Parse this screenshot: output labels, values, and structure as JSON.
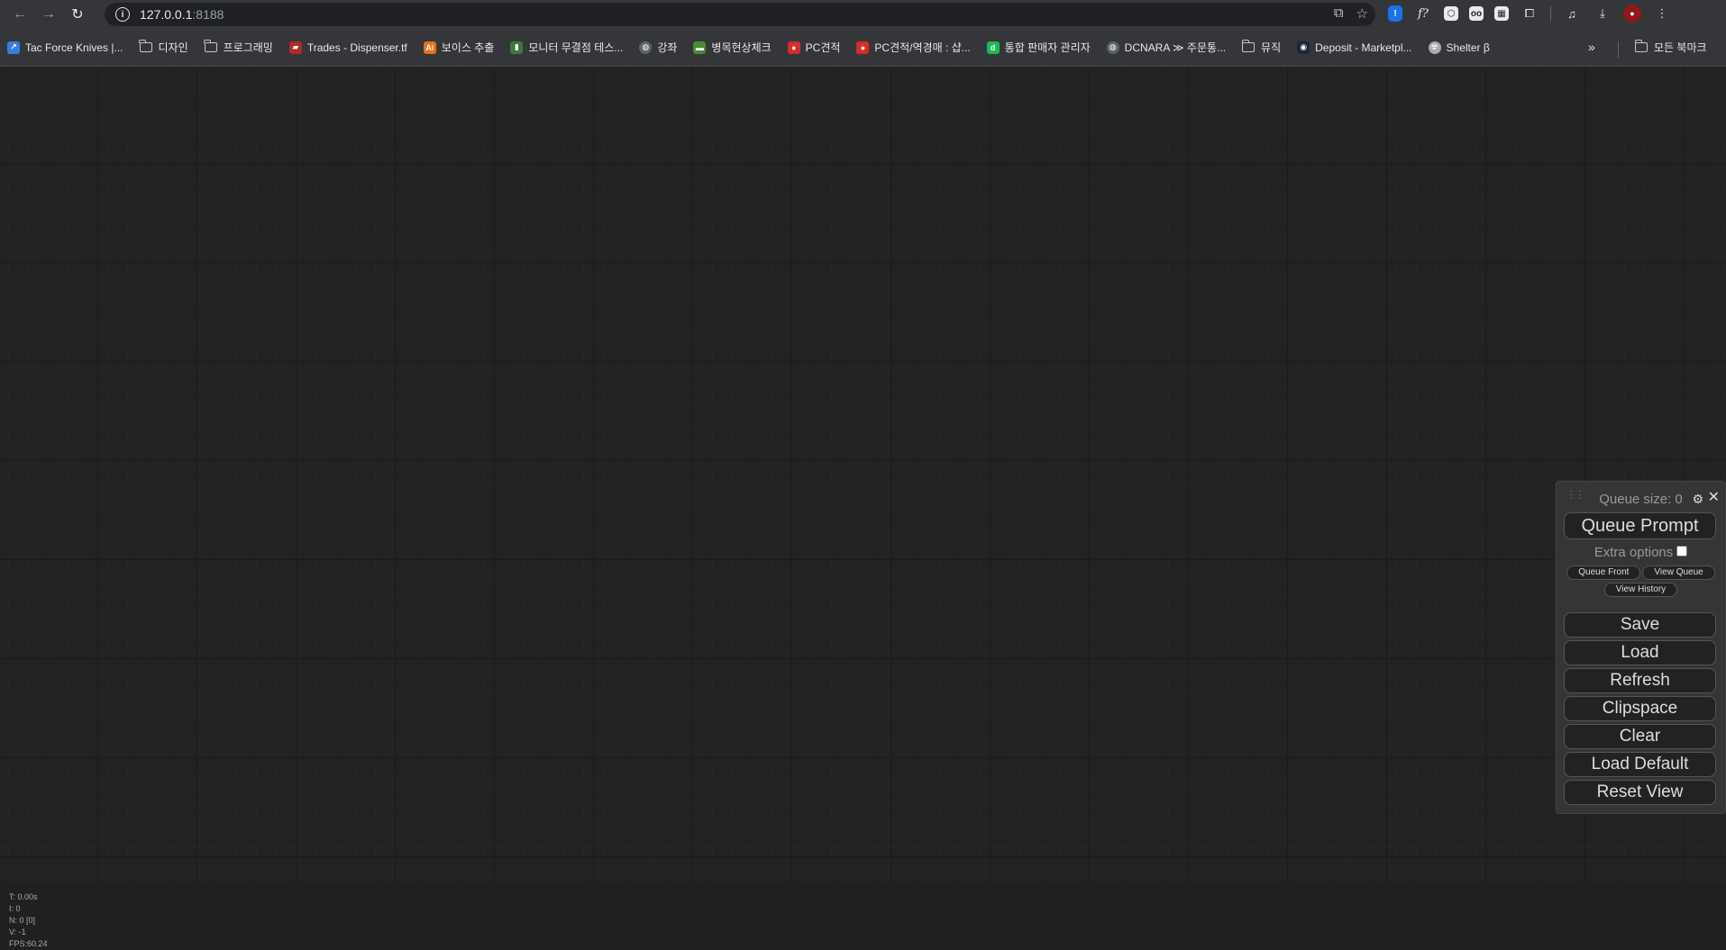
{
  "browser": {
    "url_host": "127.0.0.1",
    "url_port": ":8188",
    "bookmarks": [
      {
        "label": "Tac Force Knives |...",
        "icon": "tacforce-icon",
        "color": "#3b7dd8"
      },
      {
        "label": "디자인",
        "icon": "folder-icon"
      },
      {
        "label": "프로그래밍",
        "icon": "folder-icon"
      },
      {
        "label": "Trades - Dispenser.tf",
        "icon": "dispenser-icon",
        "color": "#b02a2a"
      },
      {
        "label": "보이스 추출",
        "icon": "voice-icon",
        "color": "#e8711a"
      },
      {
        "label": "모니터 무결점 테스...",
        "icon": "monitor-test-icon",
        "color": "#3a7a3a"
      },
      {
        "label": "강좌",
        "icon": "globe-icon",
        "color": "#5f6368"
      },
      {
        "label": "병목현상체크",
        "icon": "bottleneck-icon",
        "color": "#4a8a3a"
      },
      {
        "label": "PC견적",
        "icon": "pc-icon",
        "color": "#d62b2b"
      },
      {
        "label": "PC견적/역경매 : 샵...",
        "icon": "pc-auction-icon",
        "color": "#d62b2b"
      },
      {
        "label": "통합 판매자 관리자",
        "icon": "d-icon",
        "color": "#1db954"
      },
      {
        "label": "DCNARA ≫ 주문통...",
        "icon": "globe-icon",
        "color": "#5f6368"
      },
      {
        "label": "뮤직",
        "icon": "folder-icon"
      },
      {
        "label": "Deposit - Marketpl...",
        "icon": "steam-icon",
        "color": "#1b2838"
      },
      {
        "label": "Shelter β",
        "icon": "shelter-icon",
        "color": "#aaaaaa"
      }
    ],
    "more_label": "»",
    "all_bookmarks": "모든 북마크"
  },
  "stats": {
    "t": "T: 0.00s",
    "i": "I: 0",
    "n": "N: 0 [0]",
    "v": "V: -1",
    "fps": "FPS:60.24"
  },
  "menu": {
    "queue_size": "Queue size: 0",
    "queue_prompt": "Queue Prompt",
    "extra_options": "Extra options",
    "queue_front": "Queue Front",
    "view_queue": "View Queue",
    "view_history": "View History",
    "save": "Save",
    "load": "Load",
    "refresh": "Refresh",
    "clipspace": "Clipspace",
    "clear": "Clear",
    "load_default": "Load Default",
    "reset_view": "Reset View"
  }
}
